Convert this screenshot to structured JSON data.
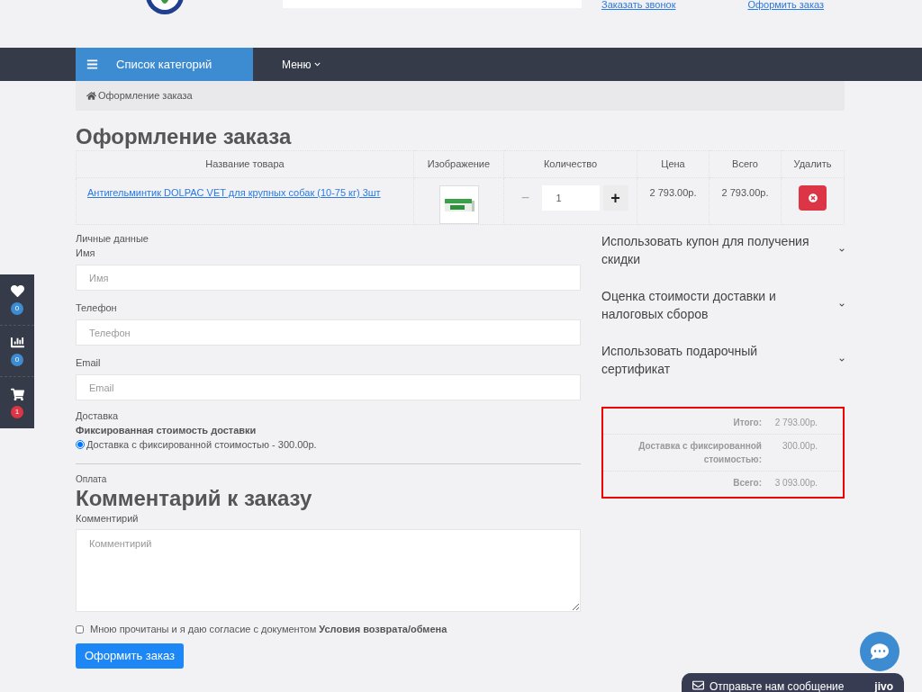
{
  "header": {
    "links": [
      {
        "label": "Заказать звонок"
      },
      {
        "label": "Оформить заказ"
      }
    ]
  },
  "nav": {
    "categories": "Список категорий",
    "menu": "Меню"
  },
  "breadcrumb": "Оформление заказа",
  "title": "Оформление заказа",
  "cart": {
    "columns": [
      "Название товара",
      "Изображение",
      "Количество",
      "Цена",
      "Всего",
      "Удалить"
    ],
    "rows": [
      {
        "name": "Антигельминтик DOLPAC VET для крупных собак (10-75 кг) 3шт",
        "quantity": "1",
        "minus": "−",
        "plus": "+",
        "price": "2 793.00р.",
        "total": "2 793.00р."
      }
    ]
  },
  "personal": {
    "heading": "Личные данные",
    "fields": [
      {
        "label": "Имя",
        "placeholder": "Имя"
      },
      {
        "label": "Телефон",
        "placeholder": "Телефон"
      },
      {
        "label": "Email",
        "placeholder": "Email"
      }
    ]
  },
  "delivery": {
    "heading": "Доставка",
    "method_title": "Фиксированная стоимость доставки",
    "options": [
      {
        "label": "Доставка с фиксированной стоимостью - 300.00р.",
        "selected": true
      }
    ]
  },
  "payment": {
    "heading": "Оплата"
  },
  "comment": {
    "title": "Комментарий к заказу",
    "label": "Комментирий",
    "placeholder": "Комментирий"
  },
  "agreement": {
    "text": "Мною прочитаны и я даю согласие с документом **Условия возврата/обмена**",
    "checked": false
  },
  "submit": "Оформить заказ",
  "accordions": [
    {
      "title": "Использовать купон для получения скидки",
      "expanded": false
    },
    {
      "title": "Оценка стоимости доставки и налоговых сборов",
      "expanded": false
    },
    {
      "title": "Использовать подарочный сертификат",
      "expanded": false
    }
  ],
  "totals": [
    {
      "label": "Итого:",
      "value": "2 793.00р."
    },
    {
      "label": "Доставка с фиксированной стоимостью:",
      "value": "300.00р."
    },
    {
      "label": "Всего:",
      "value": "3 093.00р."
    }
  ],
  "side_panel": [
    {
      "kind": "heart",
      "count": "0",
      "color": "#3d8bd0"
    },
    {
      "kind": "chart",
      "count": "0",
      "color": "#3d8bd0"
    },
    {
      "kind": "cart",
      "count": "1",
      "color": "#dc3545"
    }
  ],
  "chat": {
    "message": "Отправьте нам сообщение",
    "brand": "jivo"
  }
}
